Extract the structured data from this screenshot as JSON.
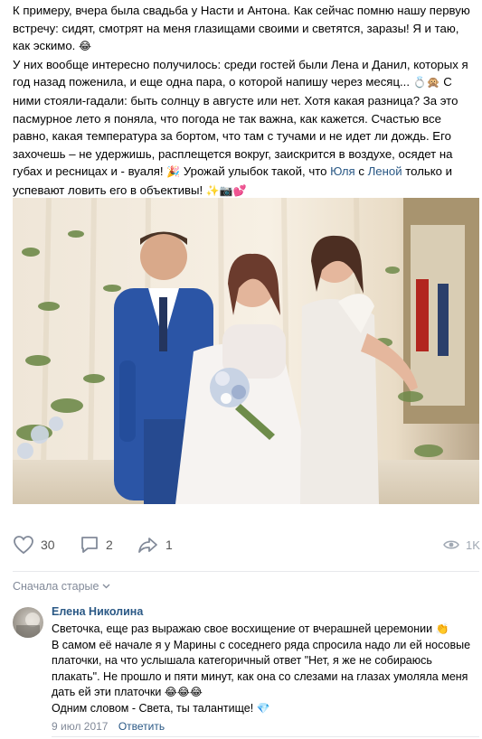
{
  "post": {
    "text": {
      "line1": "К примеру, вчера была свадьба у Насти и Антона. Как сейчас помню нашу первую встречу: сидят, смотрят на меня глазищами своими и светятся, заразы! Я и таю, как эскимо.",
      "emoji1": "😂",
      "line2a": "У них вообще интересно получилось: среди гостей были Лена и Данил, которых я год назад поженила, и еще одна пара, о которой напишу через месяц...",
      "emoji2": "💍🙊",
      "line2b": "С ними стояли-гадали: быть солнцу в августе или нет. Хотя какая разница? За это пасмурное лето я поняла, что погода не так важна, как кажется. Счастью все равно, какая температура за бортом, что там с тучами и не идет ли дождь. Его захочешь – не удержишь, расплещется вокруг, заискрится в воздухе, осядет на губах и ресницах и - вуаля!",
      "emoji3": "🎉",
      "line2c": "Урожай улыбок такой, что",
      "link1": "Юля",
      "line2d": "с",
      "link2": "Леной",
      "line2e": "только и успевают ловить его в объективы!",
      "emoji4": "✨📷💕"
    }
  },
  "actions": {
    "like_icon": "heart-icon",
    "likes": "30",
    "comment_icon": "comment-icon",
    "comments": "2",
    "share_icon": "share-icon",
    "shares": "1",
    "views_icon": "eye-icon",
    "views": "1K"
  },
  "sort_label": "Сначала старые",
  "comment": {
    "author": "Елена Николина",
    "text1": "Светочка, еще раз выражаю свое восхищение от вчерашней церемонии",
    "emoji1": "👏",
    "text2": "В самом её начале я у Марины с соседнего ряда спросила надо ли ей носовые платочки, на что услышала категоричный ответ \"Нет, я же не собираюсь плакать\". Не прошло и пяти минут, как она со слезами на глазах умоляла меня дать ей эти платочки",
    "emoji2": "😂😂😂",
    "text3": "Одним словом - Света, ты талантище!",
    "emoji3": "💎",
    "date": "9 июл 2017",
    "reply_label": "Ответить"
  },
  "colors": {
    "link": "#2a5885",
    "meta": "#828a99",
    "separator": "#e7e8ec"
  }
}
